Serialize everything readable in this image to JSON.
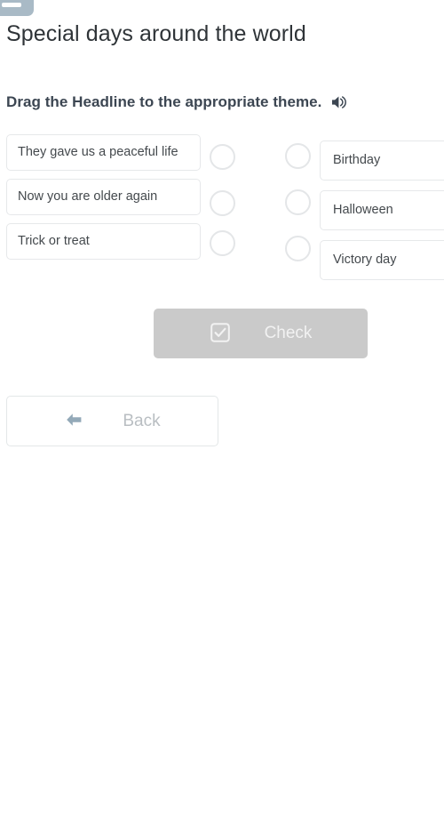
{
  "header": {
    "menu_chip_icon": "menu-chip-icon"
  },
  "page": {
    "title": "Special days around the world"
  },
  "instruction": {
    "text": "Drag the Headline to the appropriate theme.",
    "audio_icon": "speaker-icon"
  },
  "match": {
    "headlines": [
      {
        "label": "They gave us a peaceful life"
      },
      {
        "label": "Now you are older again"
      },
      {
        "label": "Trick or treat"
      }
    ],
    "themes": [
      {
        "label": "Birthday"
      },
      {
        "label": "Halloween"
      },
      {
        "label": "Victory day"
      }
    ],
    "slot_count": 3
  },
  "actions": {
    "check": {
      "label": "Check",
      "icon": "checkbox-checked-icon",
      "background": "#cacaca",
      "text_color": "#f2f2f2"
    },
    "back": {
      "label": "Back",
      "icon": "arrow-left-icon",
      "icon_color": "#93a9b8",
      "text_color": "#b9bec2"
    }
  }
}
